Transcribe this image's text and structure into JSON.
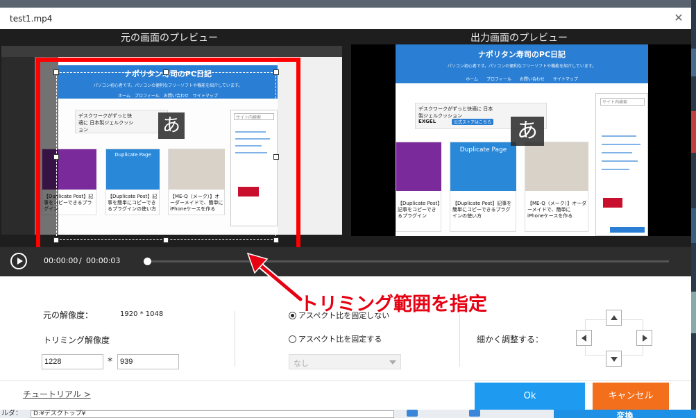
{
  "window": {
    "title": "test1.mp4"
  },
  "preview": {
    "source_label": "元の画面のプレビュー",
    "output_label": "出力画面のプレビュー"
  },
  "site": {
    "title": "ナポリタン寿司のPC日記",
    "subtitle": "パソコン初心者です。パソコンの便利なフリーソフトや機能を紹介しています。",
    "nav": [
      "ホーム",
      "プロフィール",
      "お問い合わせ",
      "サイトマップ"
    ],
    "ad_text": "デスクワークがずっと快適に 日本製ジェルクッション",
    "ad_brand": "EXGEL",
    "ad_button": "公式ストアはこちら",
    "cards": [
      {
        "thumb_text": "",
        "caption": "【Duplicate Post】記事をコピーできるプラグイン"
      },
      {
        "thumb_text": "Duplicate Page",
        "caption": "【Duplicate Post】記事を簡単にコピーできるプラグインの使い方"
      },
      {
        "thumb_text": "",
        "caption": "【ME-Q（メーク）】オーダーメイドで、簡単にiPhoneケースを作る"
      }
    ],
    "search_placeholder": "サイト内検索",
    "overlay_char": "あ"
  },
  "player": {
    "current_time": "00:00:00",
    "separator": "/",
    "total_time": "00:00:03",
    "progress": 0
  },
  "settings": {
    "orig_res_label": "元の解像度：",
    "orig_res_value": "1920 * 1048",
    "trim_res_label": "トリミング解像度",
    "width": "1228",
    "times": "*",
    "height": "939",
    "radio_unlocked": "アスペクト比を固定しない",
    "radio_locked": "アスペクト比を固定する",
    "aspect_select": "なし",
    "fine_adjust_label": "細かく調整する："
  },
  "annotation": "トリミング範囲を指定",
  "footer": {
    "tutorial": "チュートリアル >",
    "ok": "Ok",
    "cancel": "キャンセル"
  },
  "background": {
    "path_label": "ルダ：",
    "path_value": "D:¥デスクトップ¥",
    "convert_label": "変換"
  },
  "colors": {
    "accent_blue": "#1e9bf0",
    "cancel_orange": "#f36f1c",
    "annotation_red": "#e60012",
    "crop_frame_red": "#ff0000"
  }
}
